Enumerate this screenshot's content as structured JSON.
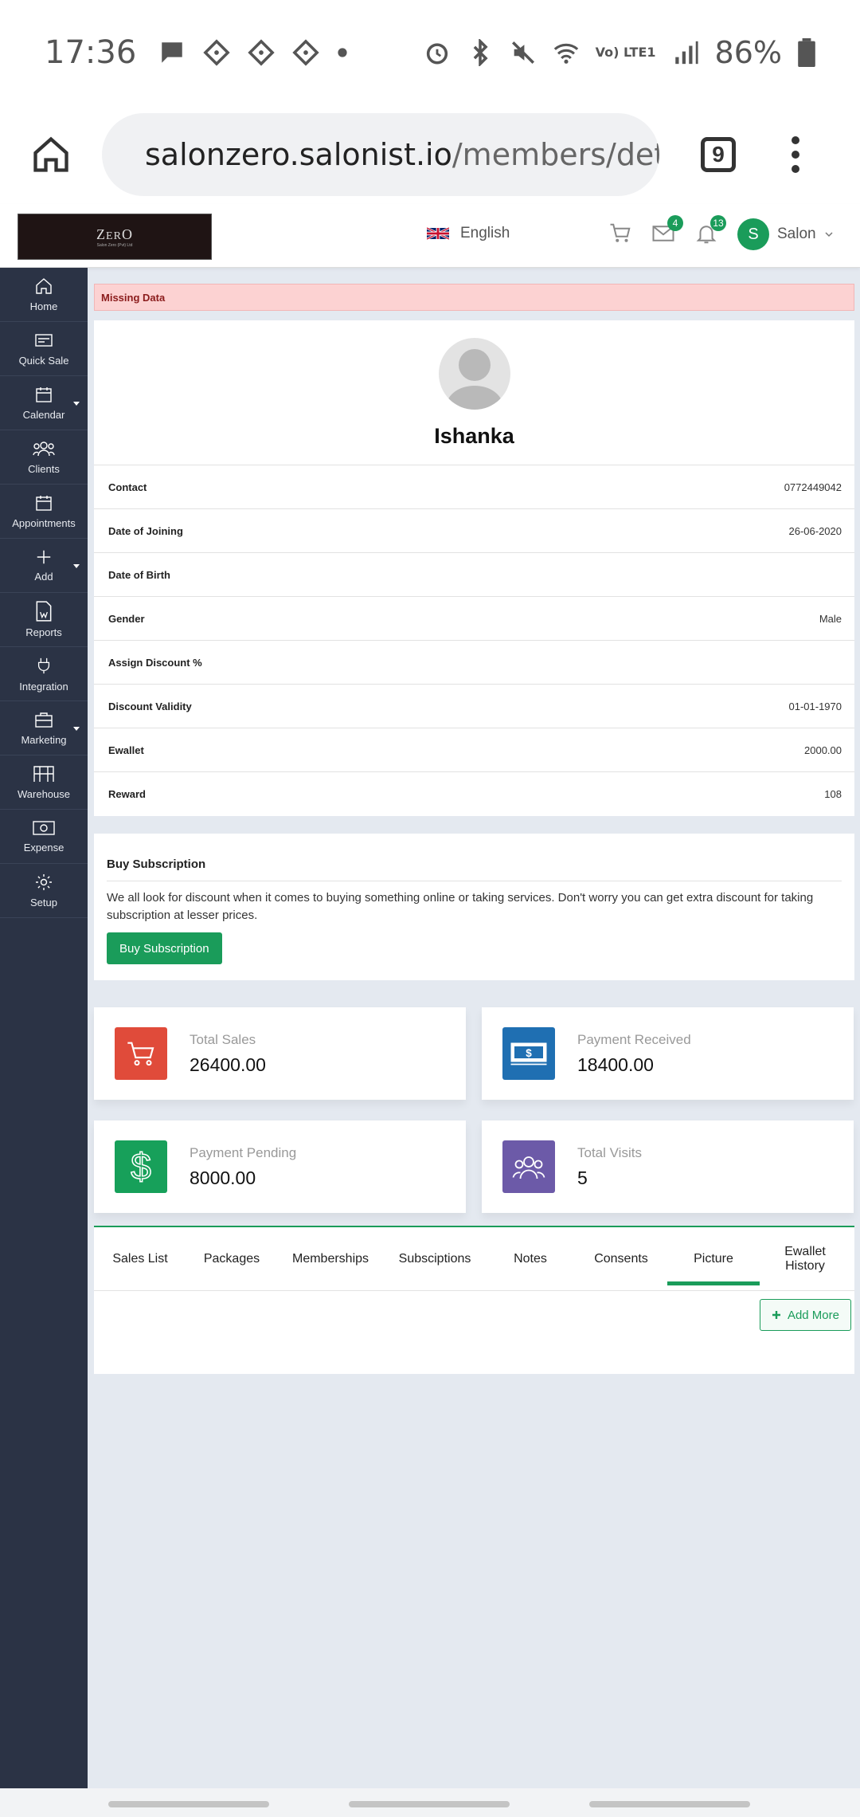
{
  "status_bar": {
    "time": "17:36",
    "battery": "86%",
    "network": "Vo) LTE1"
  },
  "browser": {
    "url_host": "salonzero.salonist.io",
    "url_path": "/members/deta",
    "tab_count": "9"
  },
  "header": {
    "language": "English",
    "mail_badge": "4",
    "notif_badge": "13",
    "user_initial": "S",
    "user_name": "Salon"
  },
  "sidebar": {
    "items": [
      {
        "label": "Home"
      },
      {
        "label": "Quick Sale"
      },
      {
        "label": "Calendar"
      },
      {
        "label": "Clients"
      },
      {
        "label": "Appointments"
      },
      {
        "label": "Add"
      },
      {
        "label": "Reports"
      },
      {
        "label": "Integration"
      },
      {
        "label": "Marketing"
      },
      {
        "label": "Warehouse"
      },
      {
        "label": "Expense"
      },
      {
        "label": "Setup"
      }
    ]
  },
  "alert": "Missing Data",
  "profile": {
    "name": "Ishanka",
    "rows": [
      {
        "k": "Contact",
        "v": "0772449042"
      },
      {
        "k": "Date of Joining",
        "v": "26-06-2020"
      },
      {
        "k": "Date of Birth",
        "v": ""
      },
      {
        "k": "Gender",
        "v": "Male"
      },
      {
        "k": "Assign Discount %",
        "v": ""
      },
      {
        "k": "Discount Validity",
        "v": "01-01-1970"
      },
      {
        "k": "Ewallet",
        "v": "2000.00"
      },
      {
        "k": "Reward",
        "v": "108"
      }
    ]
  },
  "subscription": {
    "title": "Buy Subscription",
    "text": "We all look for discount when it comes to buying something online or taking services. Don't worry you can get extra discount for taking subscription at lesser prices.",
    "button": "Buy Subscription"
  },
  "stats": {
    "total_sales": {
      "label": "Total Sales",
      "value": "26400.00",
      "color": "#e04b3a"
    },
    "payment_received": {
      "label": "Payment Received",
      "value": "18400.00",
      "color": "#1f6fb2"
    },
    "payment_pending": {
      "label": "Payment Pending",
      "value": "8000.00",
      "color": "#17a05a"
    },
    "total_visits": {
      "label": "Total Visits",
      "value": "5",
      "color": "#6c5aa8"
    }
  },
  "tabs": {
    "items": [
      {
        "label": "Sales List"
      },
      {
        "label": "Packages"
      },
      {
        "label": "Memberships"
      },
      {
        "label": "Subsciptions"
      },
      {
        "label": "Notes"
      },
      {
        "label": "Consents"
      },
      {
        "label": "Picture"
      },
      {
        "label": "Ewallet History"
      }
    ],
    "active": "Picture",
    "add_more": "Add More"
  }
}
